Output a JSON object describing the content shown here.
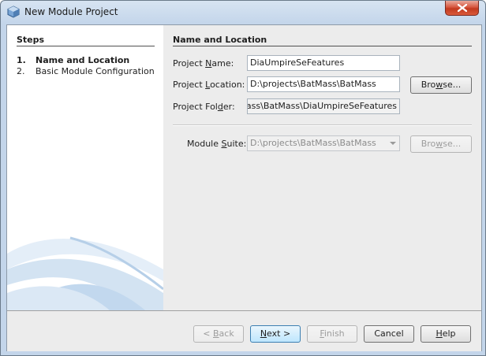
{
  "window": {
    "title": "New Module Project",
    "icon": "netbeans-cube-icon",
    "close_icon": "close-icon"
  },
  "steps": {
    "title": "Steps",
    "items": [
      {
        "num": "1.",
        "label": "Name and Location",
        "active": true
      },
      {
        "num": "2.",
        "label": "Basic Module Configuration",
        "active": false
      }
    ]
  },
  "form": {
    "section_title": "Name and Location",
    "project_name": {
      "label_pre": "Project ",
      "label_key": "N",
      "label_post": "ame:",
      "value": "DiaUmpireSeFeatures"
    },
    "project_location": {
      "label_pre": "Project ",
      "label_key": "L",
      "label_post": "ocation:",
      "value": "D:\\projects\\BatMass\\BatMass",
      "browse_key": "w",
      "browse_pre": "Bro",
      "browse_post": "se..."
    },
    "project_folder": {
      "label_pre": "Project Fol",
      "label_key": "d",
      "label_post": "er:",
      "value": "D:\\projects\\BatMass\\BatMass\\DiaUmpireSeFeatures"
    },
    "module_suite": {
      "label_pre": "Module ",
      "label_key": "S",
      "label_post": "uite:",
      "value": "D:\\projects\\BatMass\\BatMass",
      "browse_key": "w",
      "browse_pre": "Bro",
      "browse_post": "se..."
    }
  },
  "buttons": {
    "back": {
      "arrow": "< ",
      "key": "B",
      "rest": "ack"
    },
    "next": {
      "key": "N",
      "rest": "ext >"
    },
    "finish": {
      "key": "F",
      "rest": "inish"
    },
    "cancel": "Cancel",
    "help": {
      "key": "H",
      "rest": "elp"
    }
  },
  "colors": {
    "accent": "#3c7fb1",
    "close_red": "#c23a1f",
    "swirl_blue": "#a9c8e4"
  }
}
